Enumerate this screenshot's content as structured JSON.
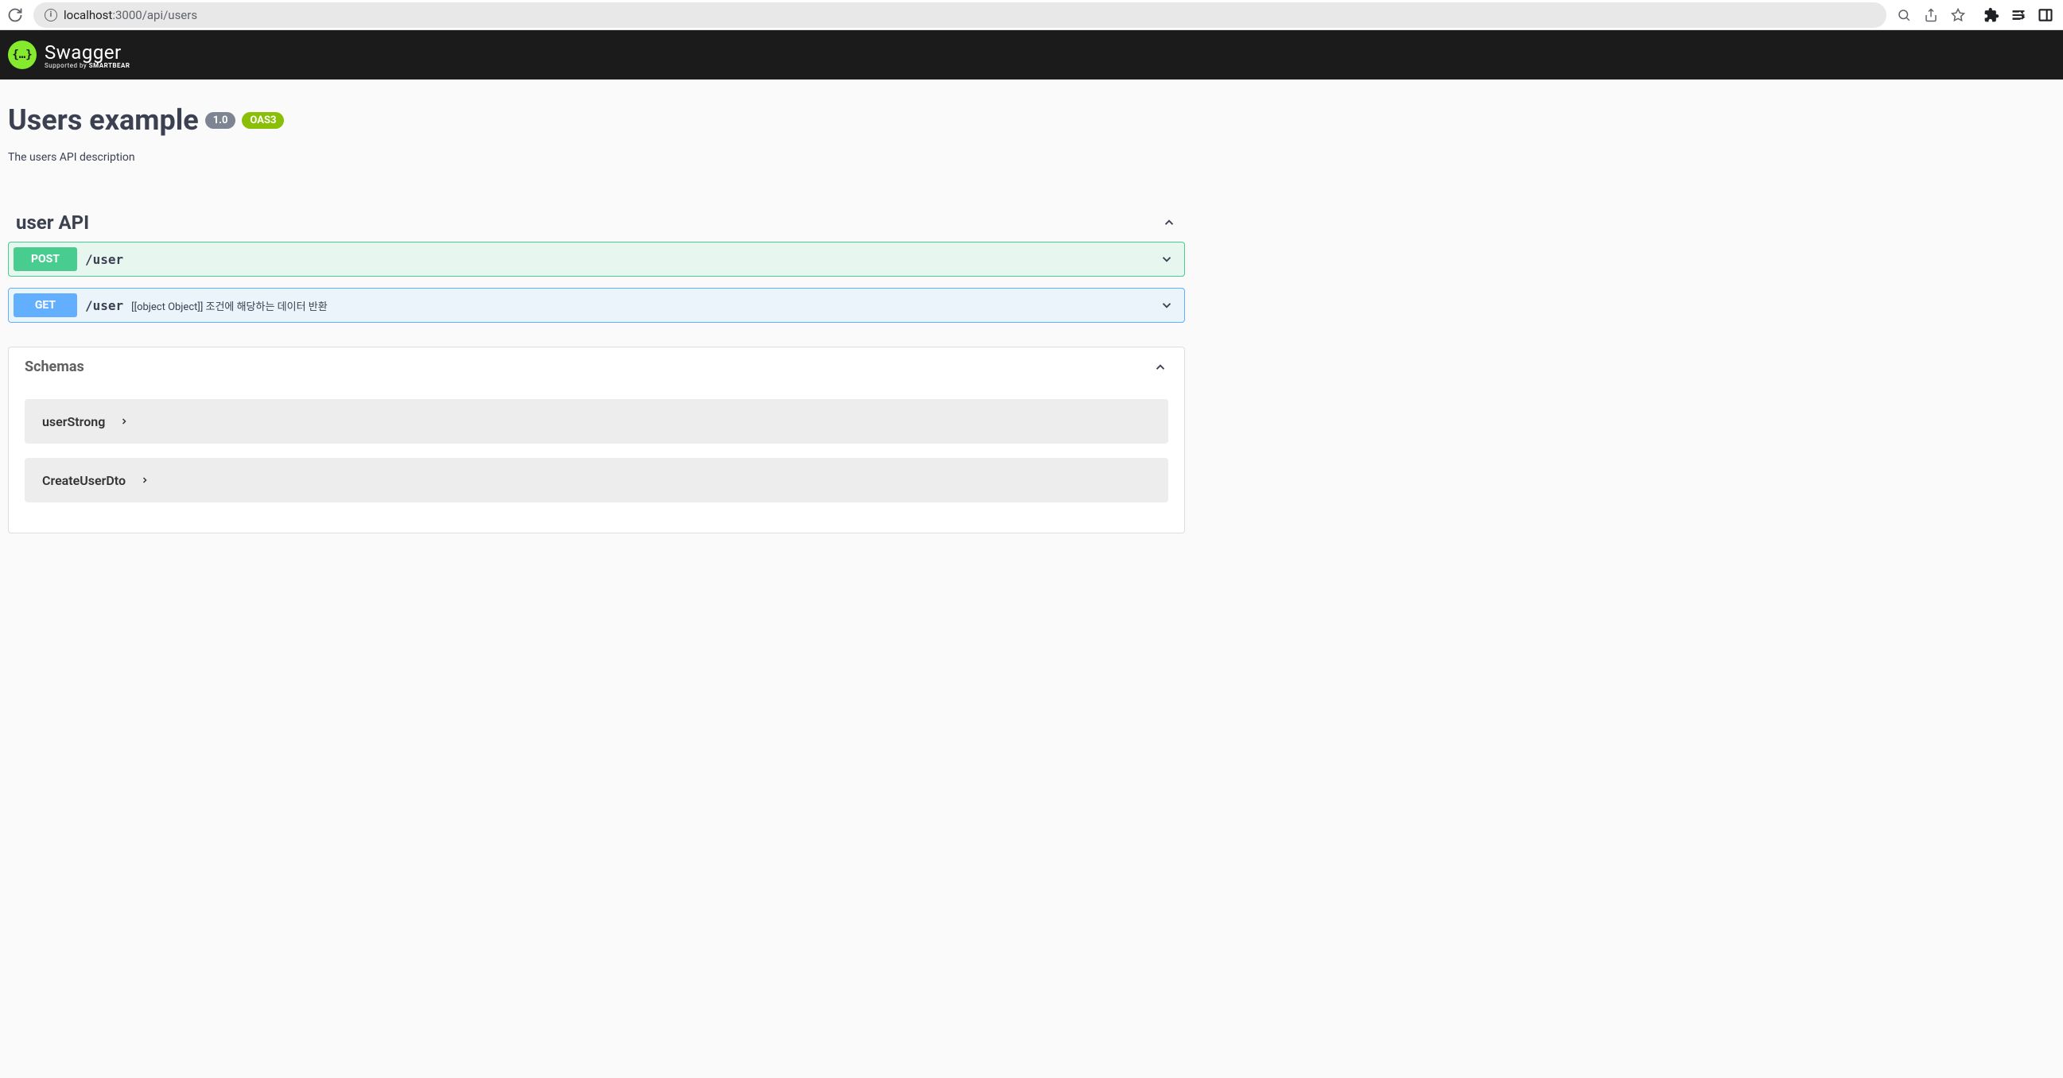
{
  "browser": {
    "url_host": "localhost",
    "url_port": ":3000",
    "url_path": "/api/users"
  },
  "header": {
    "logo_text": "Swagger",
    "logo_subtext_prefix": "Supported by ",
    "logo_subtext_bold": "SMARTBEAR"
  },
  "info": {
    "title": "Users example",
    "version": "1.0",
    "oas_label": "OAS3",
    "description": "The users API description"
  },
  "tag": {
    "name": "user API"
  },
  "operations": [
    {
      "method": "POST",
      "path": "/user",
      "summary": ""
    },
    {
      "method": "GET",
      "path": "/user",
      "summary": "[[object Object]] 조건에 해당하는 데이터 반환"
    }
  ],
  "schemas": {
    "title": "Schemas",
    "items": [
      {
        "name": "userStrong"
      },
      {
        "name": "CreateUserDto"
      }
    ]
  }
}
